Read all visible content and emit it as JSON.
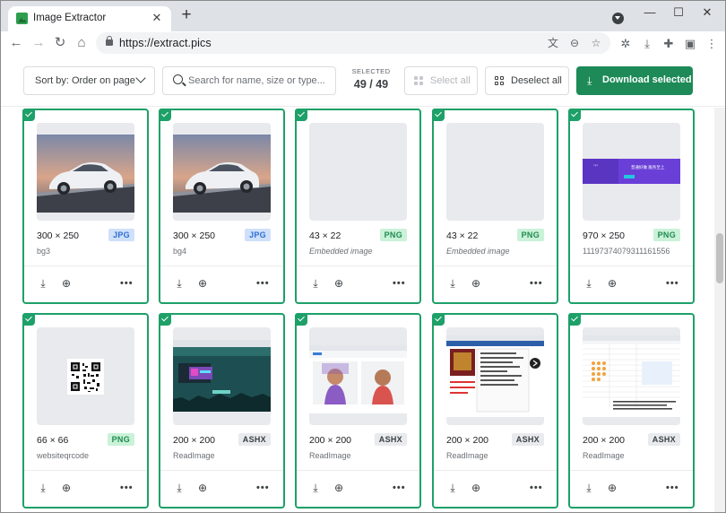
{
  "browser": {
    "tab_title": "Image Extractor",
    "url": "https://extract.pics"
  },
  "toolbar": {
    "sort_label": "Sort by: Order on page",
    "search_placeholder": "Search for name, size or type...",
    "selected_caption": "SELECTED",
    "selected_count": "49 / 49",
    "select_all": "Select all",
    "deselect_all": "Deselect all",
    "download_selected": "Download selected"
  },
  "colors": {
    "accent": "#1ea069",
    "download": "#1d8a57"
  },
  "images": [
    {
      "dims": "300 × 250",
      "type": "JPG",
      "name": "bg3",
      "thumb": "car"
    },
    {
      "dims": "300 × 250",
      "type": "JPG",
      "name": "bg4",
      "thumb": "car"
    },
    {
      "dims": "43 × 22",
      "type": "PNG",
      "name": "Embedded image",
      "thumb": "blank"
    },
    {
      "dims": "43 × 22",
      "type": "PNG",
      "name": "Embedded image",
      "thumb": "blank"
    },
    {
      "dims": "970 × 250",
      "type": "PNG",
      "name": "1119737407931116155​6",
      "thumb": "banner"
    },
    {
      "dims": "66 × 66",
      "type": "PNG",
      "name": "websiteqrcode",
      "thumb": "qr"
    },
    {
      "dims": "200 × 200",
      "type": "ASHX",
      "name": "ReadImage",
      "thumb": "screen-teal"
    },
    {
      "dims": "200 × 200",
      "type": "ASHX",
      "name": "ReadImage",
      "thumb": "screen-people"
    },
    {
      "dims": "200 × 200",
      "type": "ASHX",
      "name": "ReadImage",
      "thumb": "screen-list"
    },
    {
      "dims": "200 × 200",
      "type": "ASHX",
      "name": "ReadImage",
      "thumb": "screen-sheet"
    }
  ]
}
